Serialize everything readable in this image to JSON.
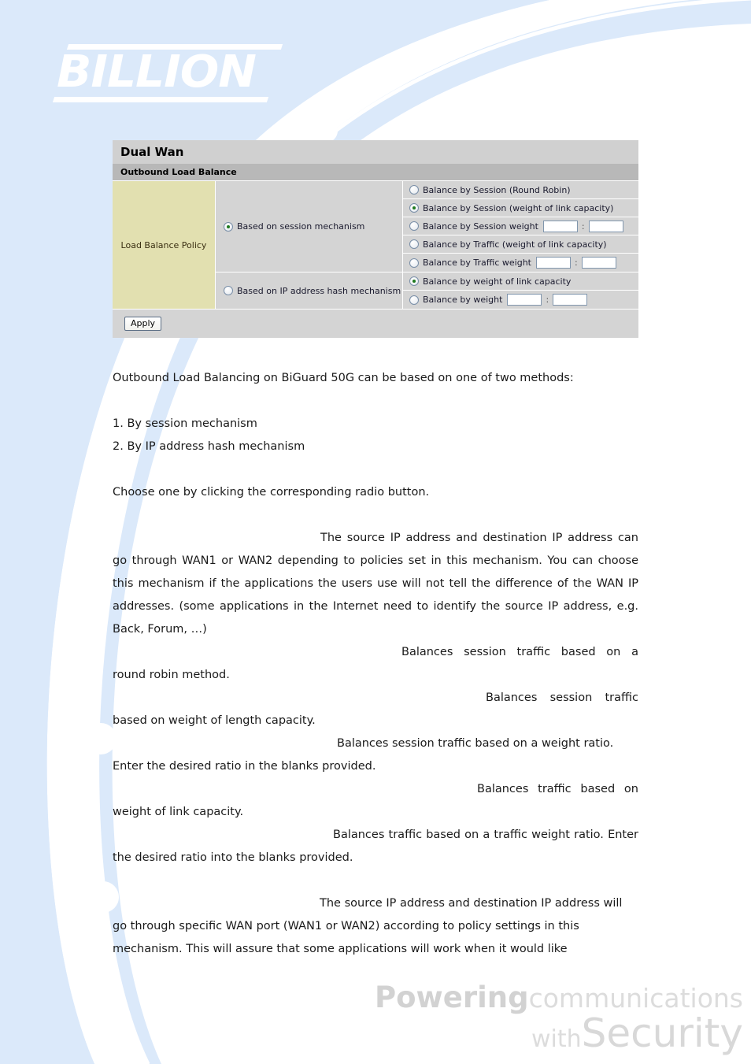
{
  "brand": {
    "logo_text": "BILLION"
  },
  "panel": {
    "title": "Dual Wan",
    "subtitle": "Outbound Load Balance",
    "policy_label": "Load Balance Policy",
    "apply_label": "Apply",
    "groups": [
      {
        "mechanism_label": "Based on session mechanism",
        "mechanism_selected": true,
        "options": [
          {
            "label": "Balance by Session (Round Robin)",
            "selected": false,
            "weights": null
          },
          {
            "label": "Balance by Session (weight of link capacity)",
            "selected": true,
            "weights": null
          },
          {
            "label": "Balance by Session weight",
            "selected": false,
            "weights": [
              "",
              ""
            ]
          },
          {
            "label": "Balance by Traffic (weight of link capacity)",
            "selected": false,
            "weights": null
          },
          {
            "label": "Balance by Traffic weight",
            "selected": false,
            "weights": [
              "",
              ""
            ]
          }
        ]
      },
      {
        "mechanism_label": "Based on IP address hash mechanism",
        "mechanism_selected": false,
        "options": [
          {
            "label": "Balance by weight of link capacity",
            "selected": true,
            "weights": null
          },
          {
            "label": "Balance by weight",
            "selected": false,
            "weights": [
              "",
              ""
            ]
          }
        ]
      }
    ],
    "weight_separator": ":"
  },
  "copy": {
    "intro": "Outbound Load Balancing on BiGuard 50G can be based on one of two methods:",
    "method_1": "1. By session mechanism",
    "method_2": "2. By IP address hash mechanism",
    "choose": "Choose one by clicking the corresponding radio button.",
    "session_mech": "The source IP address and destination IP address can go through WAN1 or WAN2 depending to policies set in this mechanism. You can choose this mechanism if the applications the users use will not tell the difference of the WAN IP addresses. (some applications in the Internet need to identify the source IP address, e.g. Back, Forum, …)",
    "round_robin": "Balances session traffic based on a round robin method.",
    "session_weight_link": "Balances session traffic based on weight of length capacity.",
    "session_weight_ratio": "Balances session traffic based on a weight ratio. Enter the desired ratio in the blanks provided.",
    "traffic_weight_link": "Balances traffic based on weight of link capacity.",
    "traffic_weight_ratio": "Balances traffic based on a traffic weight ratio. Enter the desired ratio into the blanks provided.",
    "ip_hash_mech": "The source IP address and destination IP address will go through specific WAN port (WAN1 or WAN2) according to policy settings in this mechanism. This will assure that some applications will work when it would like"
  },
  "tagline": {
    "word_powering": "Powering",
    "word_communications": "communications",
    "word_with": "with",
    "word_security": "Security"
  },
  "colors": {
    "page_blue": "#dbe9fa",
    "panel_title_bg": "#d0d0d0",
    "panel_subtitle_bg": "#b8b8b8",
    "panel_body_bg": "#d4d4d4",
    "policy_cell_bg": "#e2e0b0",
    "radio_dot_green": "#1f7a1f",
    "text_dark": "#1a1a1a"
  }
}
